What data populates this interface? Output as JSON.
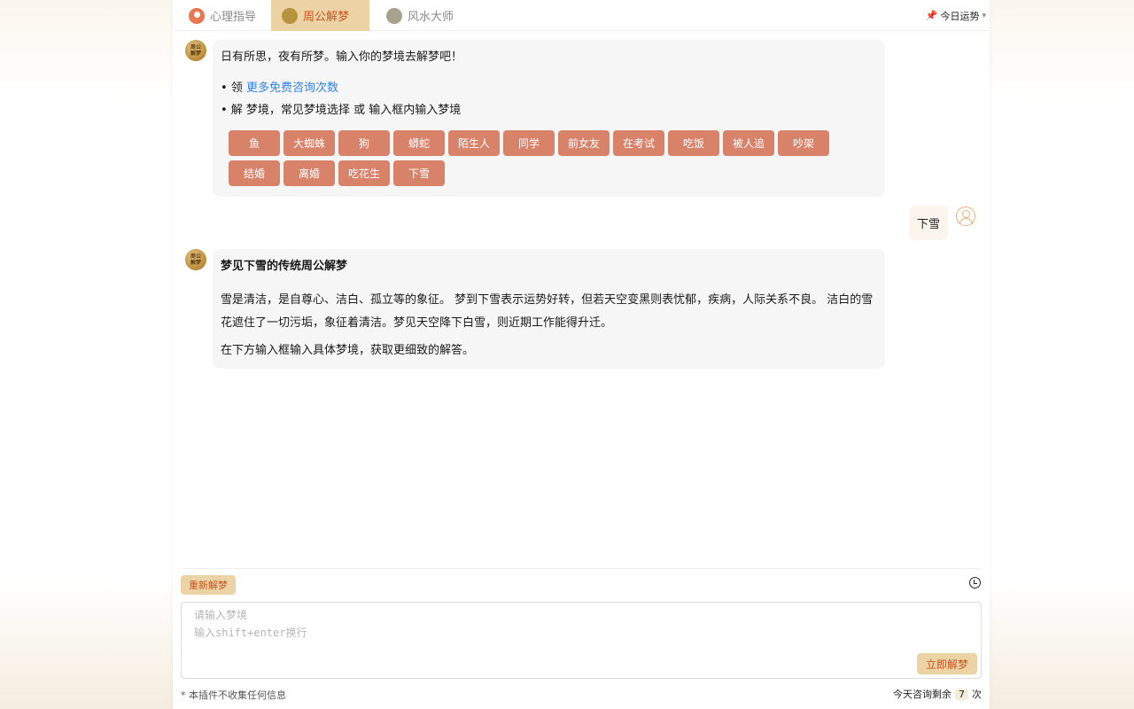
{
  "tabs": [
    {
      "label": "心理指导",
      "icon": "psychology-icon",
      "active": false
    },
    {
      "label": "周公解梦",
      "icon": "zhougong-icon",
      "active": true
    },
    {
      "label": "风水大师",
      "icon": "fengshui-icon",
      "active": false
    }
  ],
  "fortune": {
    "icon": "pin-icon",
    "label": "今日运势"
  },
  "bot_avatar_text": "周公解梦",
  "welcome": {
    "intro": "日有所思，夜有所梦。输入你的梦境去解梦吧！",
    "item1_prefix": "• 领",
    "item1_link": "更多免费咨询次数",
    "item2": "• 解 梦境，常见梦境选择 或 输入框内输入梦境"
  },
  "chips": [
    "鱼",
    "大蜘蛛",
    "狗",
    "蟒蛇",
    "陌生人",
    "同学",
    "前女友",
    "在考试",
    "吃饭",
    "被人追",
    "吵架",
    "结婚",
    "离婚",
    "吃花生",
    "下雪"
  ],
  "user_message": "下雪",
  "answer": {
    "title": "梦见下雪的传统周公解梦",
    "body": "雪是清洁，是自尊心、洁白、孤立等的象征。 梦到下雪表示运势好转，但若天空变黑则表忧郁，疾病，人际关系不良。 洁白的雪花遮住了一切污垢，象征着清洁。梦见天空降下白雪，则近期工作能得升迁。",
    "footer": "在下方输入框输入具体梦境，获取更细致的解答。"
  },
  "reset_label": "重新解梦",
  "input": {
    "placeholder": "请输入梦境\n输入shift+enter换行"
  },
  "submit_label": "立即解梦",
  "footer_note": "* 本插件不收集任何信息",
  "quota": {
    "prefix": "今天咨询剩余",
    "count": "7",
    "suffix": "次"
  }
}
